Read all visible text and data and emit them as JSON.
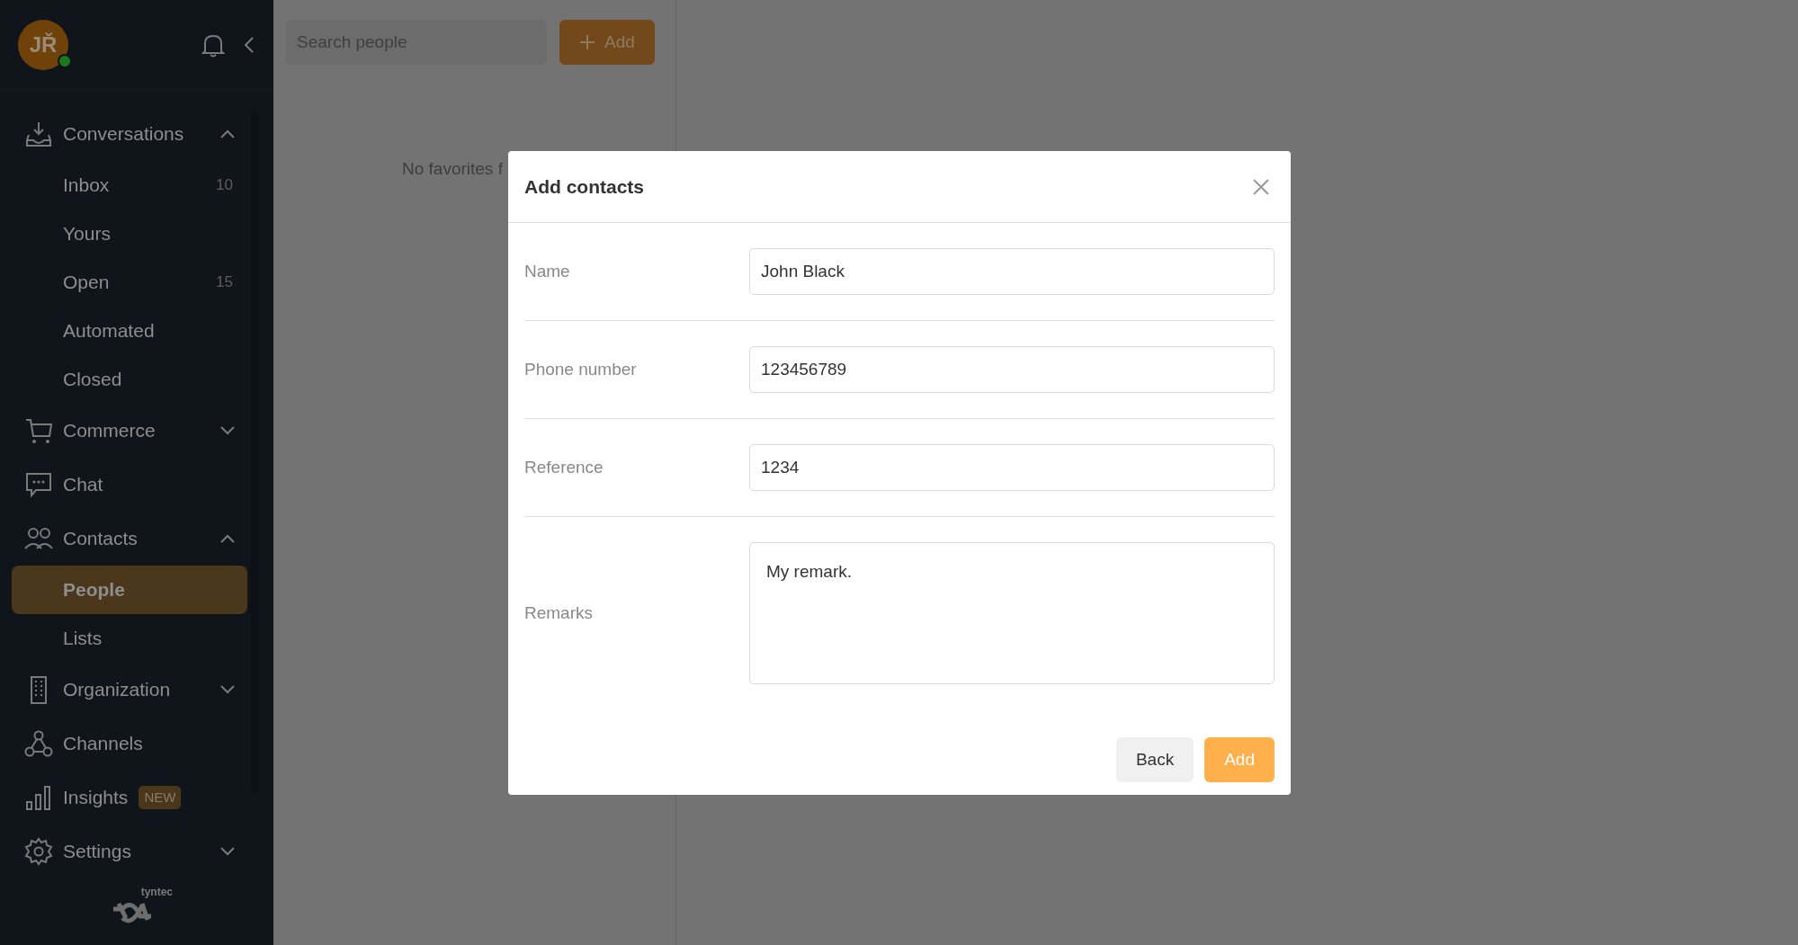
{
  "sidebar": {
    "avatar": {
      "initials": "JŘ",
      "online": true
    },
    "items": [
      {
        "label": "Conversations",
        "kind": "group",
        "expanded": true,
        "children": [
          {
            "label": "Inbox",
            "count": "10",
            "selected": false
          },
          {
            "label": "Yours",
            "selected": false
          },
          {
            "label": "Open",
            "count": "15",
            "selected": false
          },
          {
            "label": "Automated",
            "selected": false
          },
          {
            "label": "Closed",
            "selected": false
          }
        ]
      },
      {
        "label": "Commerce",
        "kind": "group",
        "expanded": false
      },
      {
        "label": "Chat",
        "kind": "link"
      },
      {
        "label": "Contacts",
        "kind": "group",
        "expanded": true,
        "children": [
          {
            "label": "People",
            "selected": true
          },
          {
            "label": "Lists",
            "selected": false
          }
        ]
      },
      {
        "label": "Organization",
        "kind": "group",
        "expanded": false
      },
      {
        "label": "Channels",
        "kind": "link"
      },
      {
        "label": "Insights",
        "kind": "link",
        "badge": "NEW"
      },
      {
        "label": "Settings",
        "kind": "group",
        "expanded": false
      }
    ],
    "logo_text": "tyntec"
  },
  "people_panel": {
    "search": {
      "placeholder": "Search people"
    },
    "add_button": "Add",
    "empty_text": "No favorites f"
  },
  "dialog": {
    "title": "Add contacts",
    "fields": [
      {
        "label": "Name",
        "kind": "input",
        "value": "John Black"
      },
      {
        "label": "Phone number",
        "kind": "input",
        "value": "123456789"
      },
      {
        "label": "Reference",
        "kind": "input",
        "value": "1234"
      },
      {
        "label": "Remarks",
        "kind": "textarea",
        "value": "My remark."
      }
    ],
    "buttons": [
      {
        "label": "Back",
        "kind": "secondary"
      },
      {
        "label": "Add",
        "kind": "primary"
      }
    ]
  }
}
